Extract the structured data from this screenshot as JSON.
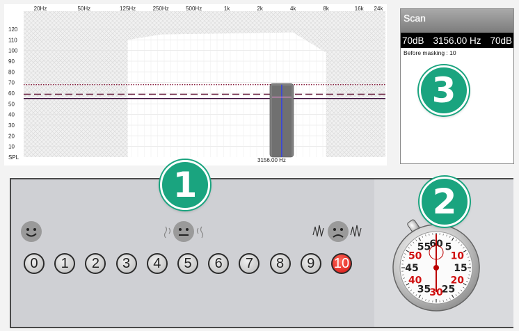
{
  "chart": {
    "freq_labels": [
      "20Hz",
      "50Hz",
      "125Hz",
      "250Hz",
      "500Hz",
      "1k",
      "2k",
      "4k",
      "8k",
      "16k",
      "24k"
    ],
    "spl_labels": [
      "120",
      "110",
      "100",
      "90",
      "80",
      "70",
      "60",
      "50",
      "40",
      "30",
      "20",
      "10",
      "SPL"
    ],
    "marker_label": "3156.00 Hz",
    "marker_frequency_hz": 3156.0,
    "levels_db": {
      "dotted": 68,
      "dashed": 59,
      "solid": 55
    },
    "colors": {
      "dotted": "#8a2040",
      "dashed": "#6a2040",
      "solid": "#3c0f3c",
      "marker_band": "#808080",
      "marker_line": "#3b49d9"
    }
  },
  "scan": {
    "title": "Scan",
    "left_level": "70dB",
    "frequency": "3156.00 Hz",
    "right_level": "70dB",
    "note": "Before masking : 10"
  },
  "badges": [
    "1",
    "2",
    "3"
  ],
  "rating": {
    "options": [
      "0",
      "1",
      "2",
      "3",
      "4",
      "5",
      "6",
      "7",
      "8",
      "9",
      "10"
    ],
    "selected": "10",
    "faces": [
      "happy-face-icon",
      "neutral-noise-face-icon",
      "sad-noise-face-icon"
    ]
  },
  "stopwatch": {
    "numbers": [
      "60",
      "5",
      "10",
      "15",
      "20",
      "25",
      "30",
      "35",
      "40",
      "45",
      "50",
      "55"
    ],
    "red_numbers": [
      "10",
      "20",
      "30",
      "40",
      "50"
    ]
  },
  "theme": {
    "accent": "#1aa47f",
    "selected_red": "#e01818"
  }
}
